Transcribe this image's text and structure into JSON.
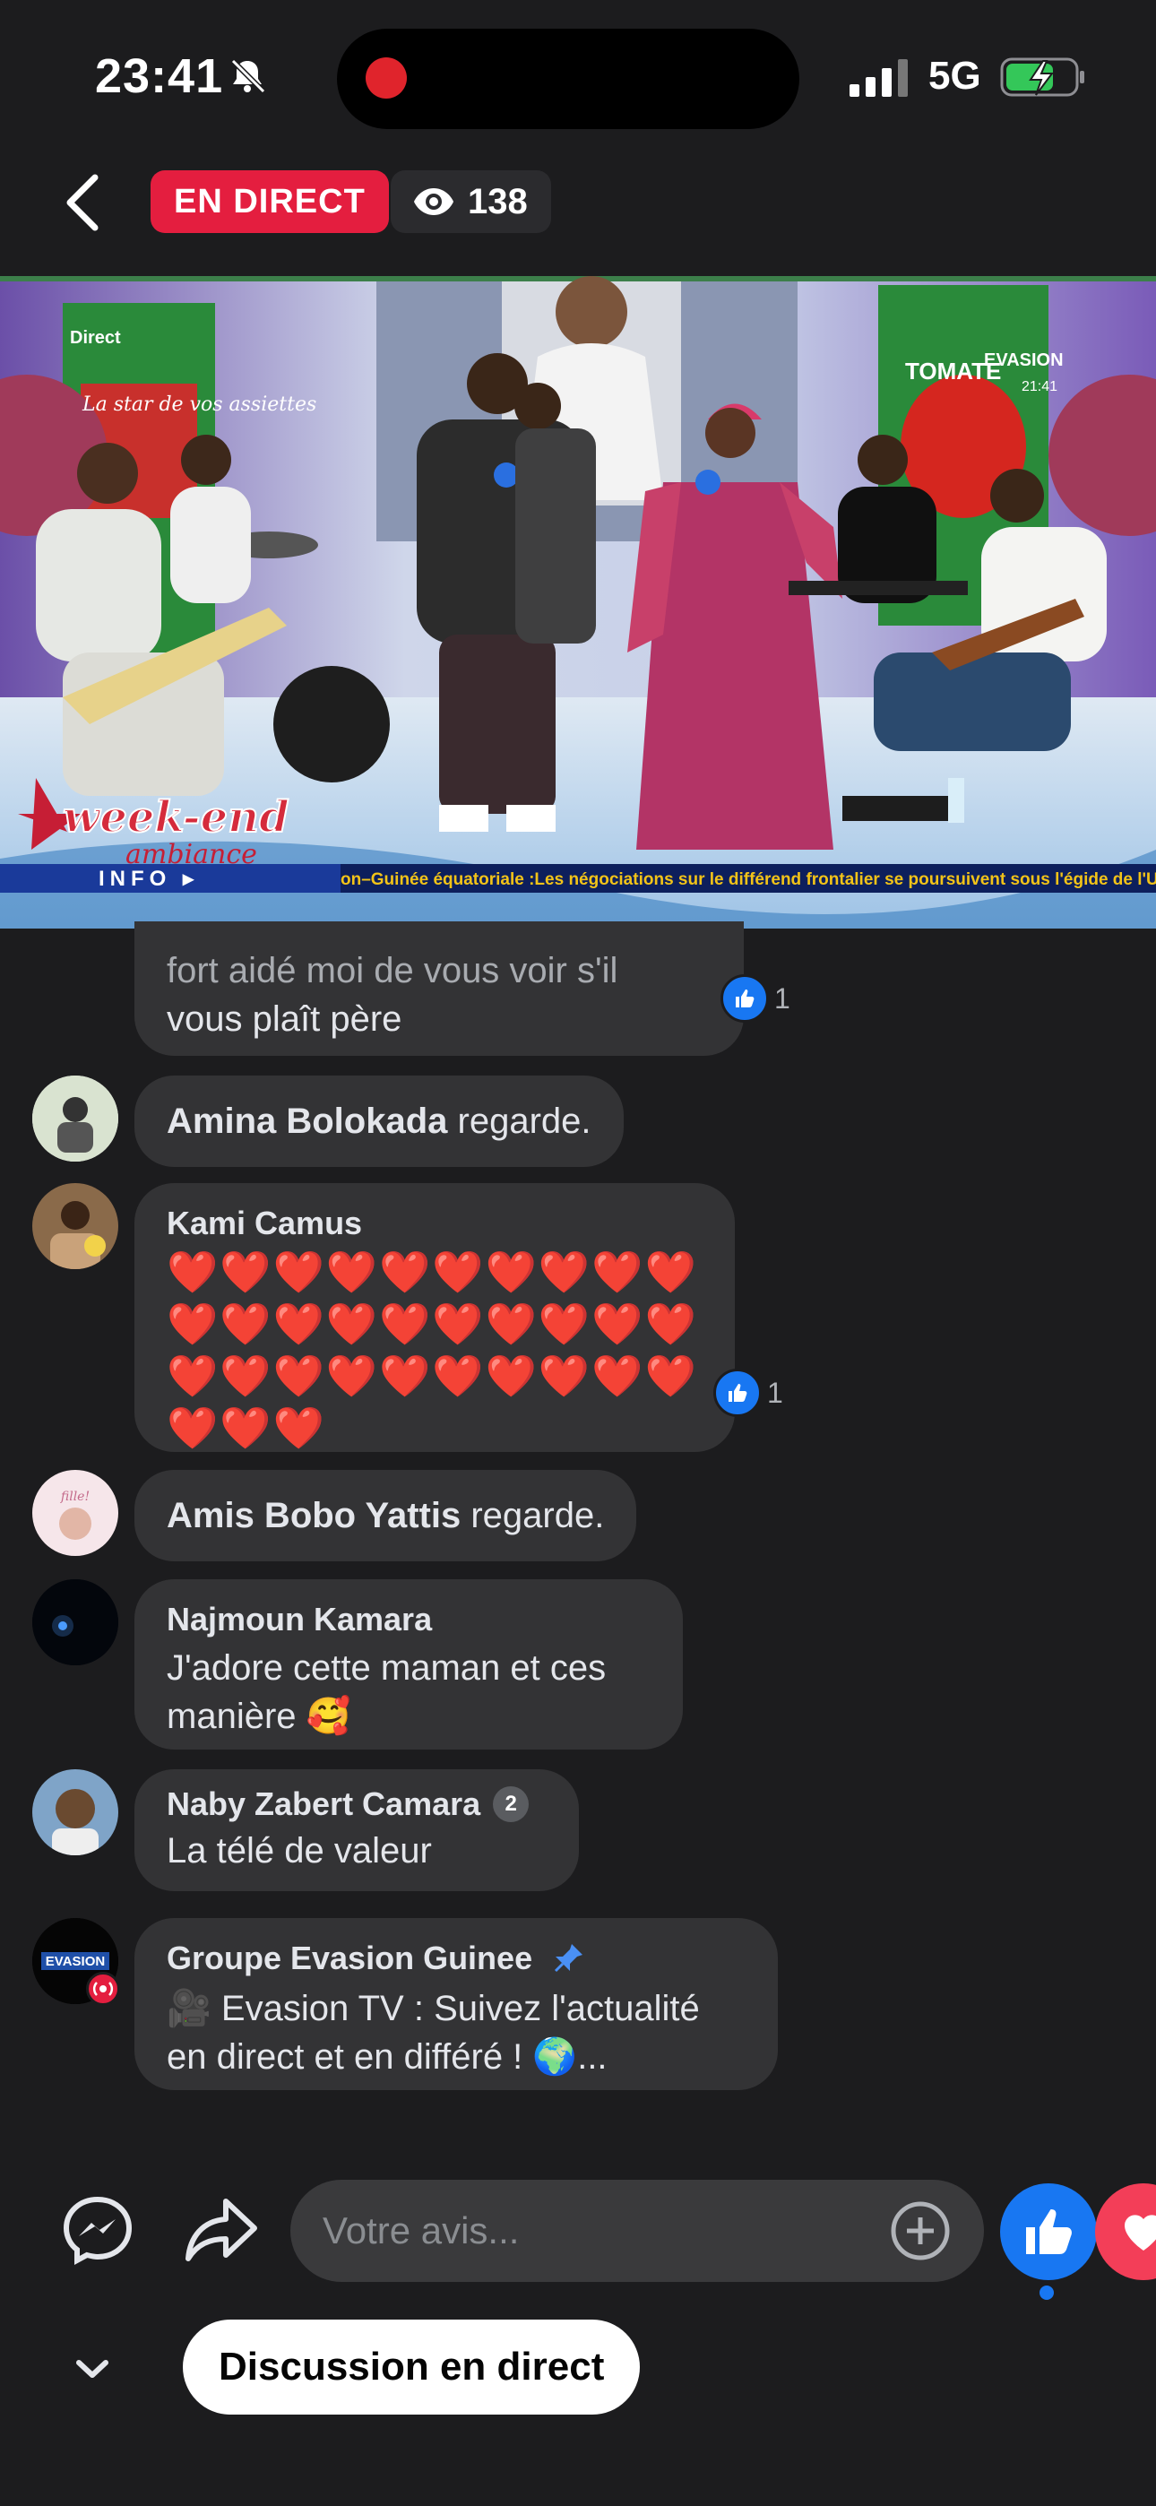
{
  "status_bar": {
    "time": "23:41",
    "network": "5G"
  },
  "header": {
    "live_label": "EN DIRECT",
    "viewer_count": "138"
  },
  "video": {
    "corner_label": "Direct",
    "channel_label": "EVASION",
    "clock": "21:41",
    "ticker_section": "INFO",
    "ticker_text": "...on–Guinée équatoriale :Les négociations sur le différend frontalier se poursuivent sous l'égide de l'Union a",
    "show_title": "week-end",
    "show_subtitle": "ambiance",
    "banner_left_text": "La star de vos assiettes",
    "banner_right_text": "TOMATE"
  },
  "comments": [
    {
      "type": "partial",
      "text_lines": [
        "fort aidé moi de vous voir s'il",
        "vous plaît père"
      ],
      "likes": "1"
    },
    {
      "type": "joined",
      "name": "Amina Bolokada",
      "action": " regarde."
    },
    {
      "type": "message",
      "name": "Kami Camus",
      "text": "❤️❤️❤️❤️❤️❤️❤️❤️❤️❤️ ❤️❤️❤️❤️❤️❤️❤️❤️❤️❤️ ❤️❤️❤️❤️❤️❤️❤️❤️❤️❤️ ❤️❤️❤️",
      "likes": "1"
    },
    {
      "type": "joined",
      "name": "Amis Bobo Yattis",
      "action": " regarde."
    },
    {
      "type": "message",
      "name": "Najmoun Kamara",
      "text_lines": [
        "J'adore cette maman et ces",
        "manière 🥰"
      ]
    },
    {
      "type": "message",
      "name": "Naby Zabert Camara",
      "badge": "2",
      "text": "La télé de valeur"
    },
    {
      "type": "pinned",
      "name": "Groupe Evasion Guinee",
      "text_lines": [
        "🎥 Evasion TV : Suivez l'actualité",
        "en direct et en différé ! 🌍..."
      ],
      "avatar_label": "EVASION"
    }
  ],
  "composer": {
    "placeholder": "Votre avis..."
  },
  "footer": {
    "discussion_button": "Discussion en direct"
  },
  "colors": {
    "background": "#1c1c1e",
    "bubble": "#333335",
    "live_red": "#e41e3f",
    "like_blue": "#1877f2",
    "heart_pink": "#f33e58"
  }
}
